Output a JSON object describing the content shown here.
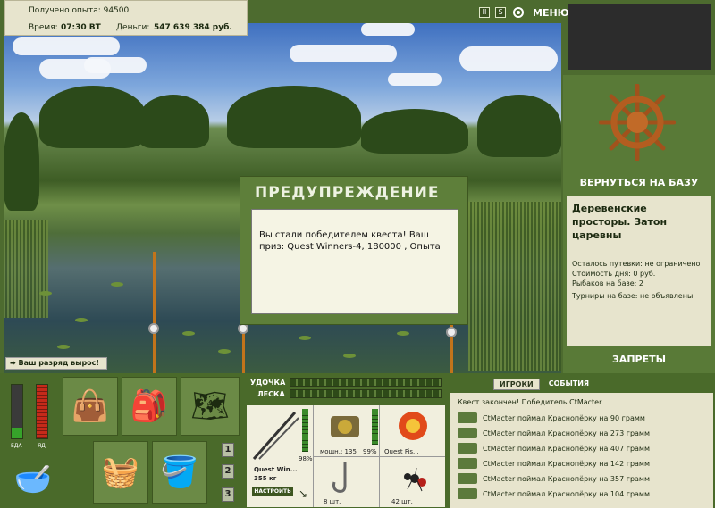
{
  "header": {
    "exp_line": "Получено опыта: 94500",
    "time_label": "Время:",
    "time_value": "07:30 ВТ",
    "money_label": "Деньги:",
    "money_value": "547 639 384 руб.",
    "pause_icon": "II",
    "s_icon": "S",
    "menu_label": "МЕНЮ"
  },
  "right_panel": {
    "base_button": "ВЕРНУТЬСЯ НА БАЗУ",
    "base_title": "Деревенские просторы. Затон царевны",
    "stats": [
      "Осталось путевки: не ограничено",
      "Стоимость дня: 0 руб.",
      "Рыбаков на базе: 2",
      "Турниры на базе: не объявлены"
    ],
    "bans_button": "ЗАПРЕТЫ"
  },
  "dialog": {
    "title": "ПРЕДУПРЕЖДЕНИЕ",
    "message": "Вы стали победителем квеста! Ваш приз: Quest Winners-4, 180000 , Опыта"
  },
  "rank_bar": "Ваш разряд вырос!",
  "meters": {
    "food_label": "ЕДА",
    "poison_label": "ЯД",
    "food_level": 0.2,
    "poison_level": 1.0
  },
  "pages": [
    "1",
    "2",
    "3"
  ],
  "tackle": {
    "rod_label": "УДОЧКА",
    "line_label": "ЛЕСКА",
    "rod_name": "Quest Win...",
    "rod_weight": "355 кг",
    "rod_percent": "98%",
    "reel_info": "мощн.: 135",
    "reel_percent": "99%",
    "line_name": "Quest Fis...",
    "hooks_count": "8 шт.",
    "bait_count": "42 шт.",
    "setup_button": "НАСТРОИТЬ"
  },
  "events": {
    "tab_players": "ИГРОКИ",
    "tab_events": "СОБЫТИЯ",
    "quest_line": "Квест закончен! Победитель CtMacter",
    "rows": [
      "CtMacter поймал Краснопёрку на 90 грамм",
      "CtMacter поймал Краснопёрку на 273 грамм",
      "CtMacter поймал Краснопёрку на 407 грамм",
      "CtMacter поймал Краснопёрку на 142 грамм",
      "CtMacter поймал Краснопёрку на 357 грамм",
      "CtMacter поймал Краснопёрку на 104 грамм"
    ]
  }
}
